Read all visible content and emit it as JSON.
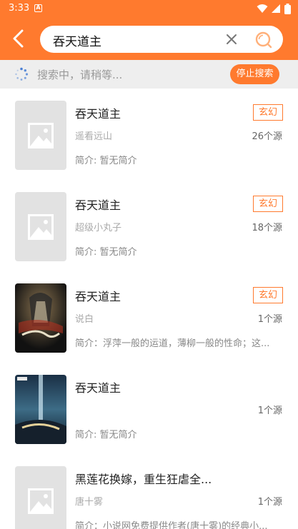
{
  "status_bar": {
    "time": "3:33",
    "notification_icon": "A"
  },
  "header": {
    "search_value": "吞天道主"
  },
  "progress": {
    "text": "搜索中，请稍等...",
    "stop_label": "停止搜索"
  },
  "results": [
    {
      "title": "吞天道主",
      "tag": "玄幻",
      "author": "遥看远山",
      "sources": "26个源",
      "intro": "简介: 暂无简介",
      "cover": "placeholder"
    },
    {
      "title": "吞天道主",
      "tag": "玄幻",
      "author": "超级小丸子",
      "sources": "18个源",
      "intro": "简介: 暂无简介",
      "cover": "placeholder"
    },
    {
      "title": "吞天道主",
      "tag": "玄幻",
      "author": "说白",
      "sources": "1个源",
      "intro": "简介：浮萍一般的运道，薄柳一般的性命；这...",
      "cover": "art-dark"
    },
    {
      "title": "吞天道主",
      "tag": "",
      "author": "",
      "sources": "1个源",
      "intro": "简介: 暂无简介",
      "cover": "art-blue"
    },
    {
      "title": "黑莲花换嫁，重生狂虐全...",
      "tag": "",
      "author": "唐十雾",
      "sources": "1个源",
      "intro": "简介：小说网免费提供作者(唐十雾)的经典小...",
      "cover": "placeholder"
    }
  ],
  "colors": {
    "accent": "#ff7a2e",
    "muted": "#aaaaaa",
    "placeholder": "#e2e2e2"
  }
}
